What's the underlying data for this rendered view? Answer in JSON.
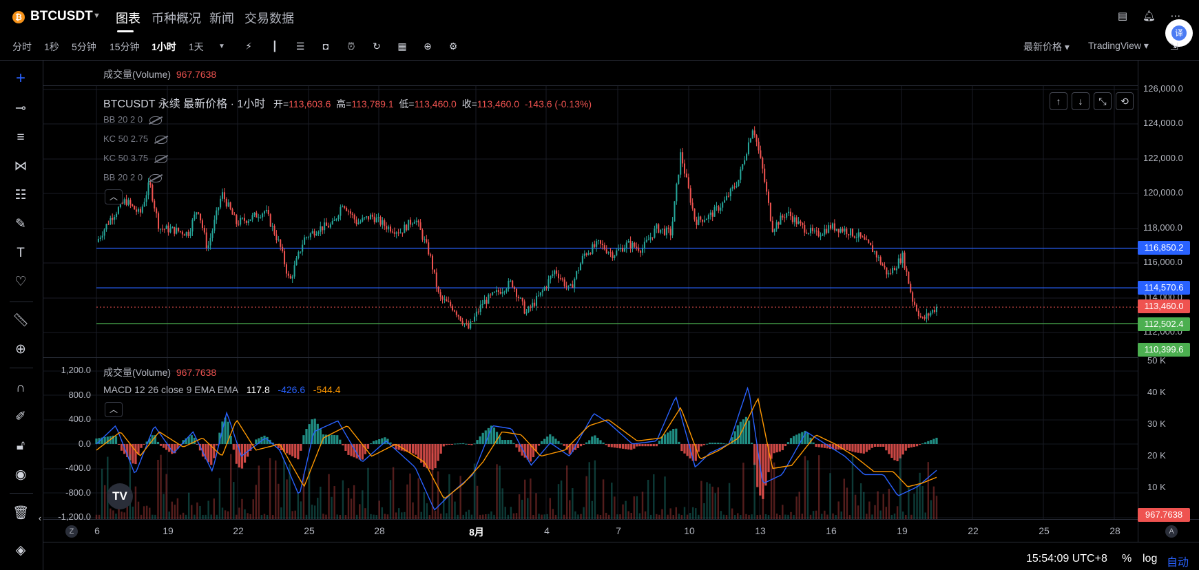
{
  "header": {
    "symbol": "BTCUSDT",
    "symbol_icon": "bitcoin-icon",
    "tabs": [
      "图表",
      "币种概况",
      "新闻",
      "交易数据"
    ]
  },
  "toolbar": {
    "intervals": [
      "分时",
      "1秒",
      "5分钟",
      "15分钟",
      "1小时",
      "1天"
    ],
    "active_interval": "1小时",
    "price_type": "最新价格",
    "chart_type": "TradingView"
  },
  "pane_top_label": {
    "name": "成交量(Volume)",
    "value": "967.7638"
  },
  "legend": {
    "title": "BTCUSDT 永续 最新价格 · 1小时",
    "open_label": "开=",
    "open": "113,603.6",
    "high_label": "高=",
    "high": "113,789.1",
    "low_label": "低=",
    "low": "113,460.0",
    "close_label": "收=",
    "close": "113,460.0",
    "change": "-143.6 (-0.13%)"
  },
  "indicators": [
    "BB 20 2 0",
    "KC 50 2.75",
    "KC 50 3.75",
    "BB 20 2 0"
  ],
  "lower_pane": {
    "volume_label": "成交量(Volume)",
    "volume_value": "967.7638",
    "macd_label": "MACD 12 26 close 9 EMA EMA",
    "macd_hist": "117.8",
    "macd_line": "-426.6",
    "macd_signal": "-544.4"
  },
  "price_axis": {
    "ticks": [
      "126,000.0",
      "124,000.0",
      "122,000.0",
      "120,000.0",
      "118,000.0",
      "116,000.0",
      "114,000.0",
      "112,000.0"
    ],
    "level_badges": [
      "116,850.2",
      "114,570.6",
      "113,460.0",
      "112,502.4",
      "110,399.6"
    ]
  },
  "macd_axis": {
    "ticks": [
      "1,200.0",
      "800.0",
      "400.0",
      "0.0",
      "-400.0",
      "-800.0",
      "-1,200.0"
    ]
  },
  "volume_axis": {
    "ticks": [
      "50 K",
      "40 K",
      "30 K",
      "20 K",
      "10 K"
    ],
    "badge": "967.7638"
  },
  "time_axis": {
    "ticks": [
      "6",
      "19",
      "22",
      "25",
      "28",
      "8月",
      "4",
      "7",
      "10",
      "13",
      "16",
      "19",
      "22",
      "25",
      "28"
    ],
    "z_button": "Z",
    "a_button": "A"
  },
  "bottom_bar": {
    "clock": "15:54:09 UTC+8",
    "percent": "%",
    "log": "log",
    "auto": "自动"
  },
  "colors": {
    "up": "#26a69a",
    "down": "#ef5350",
    "level_line": "#2962ff",
    "support_line": "#4caf50",
    "macd_line": "#2962ff",
    "signal_line": "#ff9800",
    "accent": "#2962ff"
  },
  "chart_data": {
    "type": "candlestick",
    "title": "BTCUSDT 永续 最新价格 · 1小时",
    "price_ylim": [
      110000,
      126000
    ],
    "x_ticks": [
      "6",
      "19",
      "22",
      "25",
      "28",
      "8月",
      "4",
      "7",
      "10",
      "13",
      "16",
      "19",
      "22",
      "25",
      "28"
    ],
    "horizontal_levels": [
      116850.2,
      114570.6,
      112502.4
    ],
    "last_price": 113460.0,
    "price_path": [
      [
        0,
        117200
      ],
      [
        3,
        118600
      ],
      [
        6,
        119600
      ],
      [
        9,
        118800
      ],
      [
        11,
        120600
      ],
      [
        13,
        118000
      ],
      [
        16,
        117900
      ],
      [
        19,
        117700
      ],
      [
        21,
        119200
      ],
      [
        23,
        116800
      ],
      [
        26,
        120000
      ],
      [
        29,
        118300
      ],
      [
        32,
        118600
      ],
      [
        35,
        119000
      ],
      [
        38,
        117000
      ],
      [
        40,
        114900
      ],
      [
        43,
        117400
      ],
      [
        46,
        118000
      ],
      [
        49,
        118200
      ],
      [
        51,
        119500
      ],
      [
        54,
        118300
      ],
      [
        57,
        118700
      ],
      [
        60,
        118100
      ],
      [
        63,
        117800
      ],
      [
        66,
        118600
      ],
      [
        69,
        116500
      ],
      [
        71,
        114000
      ],
      [
        74,
        113400
      ],
      [
        77,
        112200
      ],
      [
        80,
        113700
      ],
      [
        83,
        114300
      ],
      [
        86,
        114900
      ],
      [
        89,
        113100
      ],
      [
        92,
        114200
      ],
      [
        95,
        115600
      ],
      [
        98,
        114400
      ],
      [
        101,
        116500
      ],
      [
        104,
        117100
      ],
      [
        107,
        116500
      ],
      [
        110,
        117100
      ],
      [
        113,
        116800
      ],
      [
        116,
        118000
      ],
      [
        119,
        117700
      ],
      [
        121,
        122300
      ],
      [
        124,
        118400
      ],
      [
        127,
        118700
      ],
      [
        130,
        119500
      ],
      [
        133,
        120800
      ],
      [
        136,
        123900
      ],
      [
        138,
        121300
      ],
      [
        140,
        118000
      ],
      [
        143,
        118900
      ],
      [
        146,
        118100
      ],
      [
        149,
        117600
      ],
      [
        152,
        118100
      ],
      [
        155,
        117900
      ],
      [
        158,
        117500
      ],
      [
        161,
        116700
      ],
      [
        164,
        115300
      ],
      [
        167,
        116400
      ],
      [
        169,
        113900
      ],
      [
        171,
        112700
      ],
      [
        174,
        113460
      ]
    ],
    "macd": {
      "ylim": [
        -1200,
        1200
      ],
      "macd_line": [
        [
          0,
          0
        ],
        [
          4,
          300
        ],
        [
          8,
          -500
        ],
        [
          12,
          300
        ],
        [
          16,
          -150
        ],
        [
          20,
          200
        ],
        [
          24,
          -450
        ],
        [
          27,
          520
        ],
        [
          30,
          -200
        ],
        [
          35,
          100
        ],
        [
          38,
          -100
        ],
        [
          42,
          -850
        ],
        [
          45,
          200
        ],
        [
          50,
          380
        ],
        [
          55,
          -300
        ],
        [
          60,
          50
        ],
        [
          66,
          -380
        ],
        [
          70,
          -1080
        ],
        [
          74,
          -770
        ],
        [
          78,
          -500
        ],
        [
          82,
          300
        ],
        [
          86,
          250
        ],
        [
          90,
          -350
        ],
        [
          94,
          20
        ],
        [
          98,
          -200
        ],
        [
          103,
          500
        ],
        [
          106,
          350
        ],
        [
          111,
          0
        ],
        [
          116,
          50
        ],
        [
          120,
          780
        ],
        [
          124,
          -380
        ],
        [
          127,
          -150
        ],
        [
          131,
          0
        ],
        [
          135,
          950
        ],
        [
          138,
          -650
        ],
        [
          142,
          -500
        ],
        [
          147,
          200
        ],
        [
          151,
          0
        ],
        [
          155,
          -200
        ],
        [
          159,
          -500
        ],
        [
          163,
          -500
        ],
        [
          166,
          -850
        ],
        [
          170,
          -700
        ],
        [
          174,
          -430
        ]
      ],
      "signal_line": [
        [
          0,
          -100
        ],
        [
          5,
          200
        ],
        [
          9,
          -200
        ],
        [
          13,
          200
        ],
        [
          18,
          -50
        ],
        [
          22,
          100
        ],
        [
          26,
          -200
        ],
        [
          29,
          400
        ],
        [
          33,
          -100
        ],
        [
          38,
          0
        ],
        [
          43,
          -700
        ],
        [
          47,
          100
        ],
        [
          52,
          300
        ],
        [
          57,
          -200
        ],
        [
          62,
          0
        ],
        [
          68,
          -300
        ],
        [
          72,
          -900
        ],
        [
          76,
          -650
        ],
        [
          80,
          -300
        ],
        [
          84,
          200
        ],
        [
          88,
          150
        ],
        [
          92,
          -200
        ],
        [
          97,
          -100
        ],
        [
          102,
          300
        ],
        [
          106,
          400
        ],
        [
          112,
          50
        ],
        [
          117,
          100
        ],
        [
          121,
          600
        ],
        [
          125,
          -250
        ],
        [
          129,
          -100
        ],
        [
          133,
          100
        ],
        [
          137,
          750
        ],
        [
          140,
          -400
        ],
        [
          144,
          -350
        ],
        [
          149,
          150
        ],
        [
          153,
          0
        ],
        [
          157,
          -200
        ],
        [
          161,
          -450
        ],
        [
          165,
          -450
        ],
        [
          168,
          -700
        ],
        [
          171,
          -640
        ],
        [
          174,
          -544
        ]
      ]
    }
  }
}
